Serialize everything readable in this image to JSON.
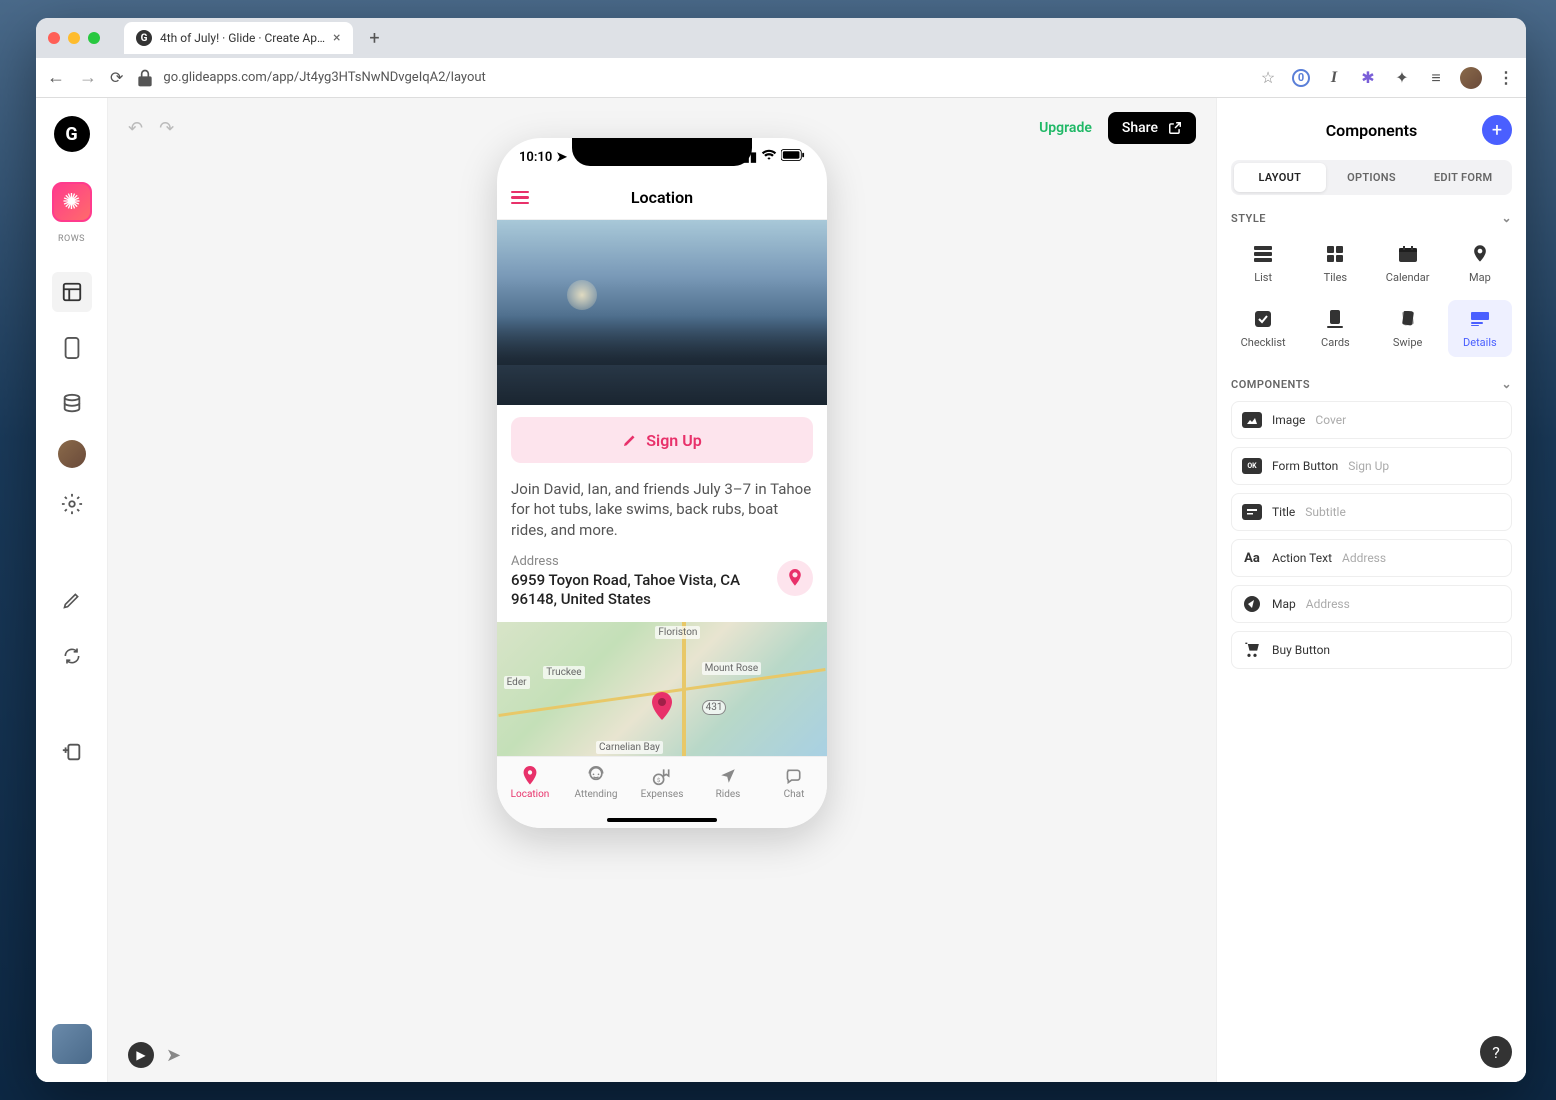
{
  "browser": {
    "tab_title": "4th of July! · Glide · Create Ap…",
    "url": "go.glideapps.com/app/Jt4yg3HTsNwNDvgeIqA2/layout"
  },
  "left_rail": {
    "logo_letter": "G",
    "rows_label": "ROWS"
  },
  "canvas": {
    "upgrade_label": "Upgrade",
    "share_label": "Share"
  },
  "phone": {
    "time": "10:10",
    "header_title": "Location",
    "signup_label": "Sign Up",
    "subtitle": "Join David, Ian, and friends July 3–7 in Tahoe for hot tubs, lake swims, back rubs, boat rides, and more.",
    "address_label": "Address",
    "address_value": "6959 Toyon Road, Tahoe Vista, CA 96148, United States",
    "map_labels": {
      "truckee": "Truckee",
      "floriston": "Floriston",
      "mount_rose": "Mount Rose",
      "carnelian": "Carnelian Bay",
      "eder": "Eder",
      "route": "431"
    },
    "tabs": [
      {
        "label": "Location",
        "active": true
      },
      {
        "label": "Attending",
        "active": false
      },
      {
        "label": "Expenses",
        "active": false
      },
      {
        "label": "Rides",
        "active": false
      },
      {
        "label": "Chat",
        "active": false
      }
    ]
  },
  "panel": {
    "title": "Components",
    "tabs": {
      "layout": "LAYOUT",
      "options": "OPTIONS",
      "edit_form": "EDIT FORM"
    },
    "style_label": "STYLE",
    "styles": [
      {
        "label": "List"
      },
      {
        "label": "Tiles"
      },
      {
        "label": "Calendar"
      },
      {
        "label": "Map"
      },
      {
        "label": "Checklist"
      },
      {
        "label": "Cards"
      },
      {
        "label": "Swipe"
      },
      {
        "label": "Details"
      }
    ],
    "components_label": "COMPONENTS",
    "components": [
      {
        "name": "Image",
        "sub": "Cover"
      },
      {
        "name": "Form Button",
        "sub": "Sign Up"
      },
      {
        "name": "Title",
        "sub": "Subtitle"
      },
      {
        "name": "Action Text",
        "sub": "Address"
      },
      {
        "name": "Map",
        "sub": "Address"
      },
      {
        "name": "Buy Button",
        "sub": ""
      }
    ],
    "help": "?"
  }
}
